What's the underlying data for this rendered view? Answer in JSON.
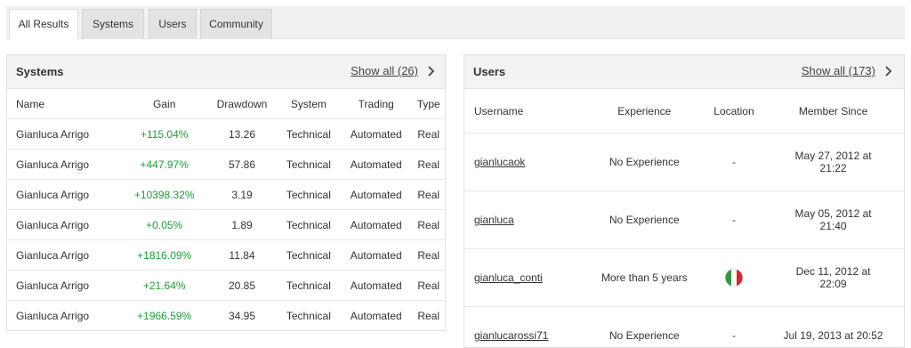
{
  "tabs": [
    "All Results",
    "Systems",
    "Users",
    "Community"
  ],
  "systems": {
    "title": "Systems",
    "show_all": "Show all (26)",
    "columns": [
      "Name",
      "Gain",
      "Drawdown",
      "System",
      "Trading",
      "Type"
    ],
    "rows": [
      {
        "name": "Gianluca Arrigo",
        "gain": "+115.04%",
        "drawdown": "13.26",
        "system": "Technical",
        "trading": "Automated",
        "type": "Real"
      },
      {
        "name": "Gianluca Arrigo",
        "gain": "+447.97%",
        "drawdown": "57.86",
        "system": "Technical",
        "trading": "Automated",
        "type": "Real"
      },
      {
        "name": "Gianluca Arrigo",
        "gain": "+10398.32%",
        "drawdown": "3.19",
        "system": "Technical",
        "trading": "Automated",
        "type": "Real"
      },
      {
        "name": "Gianluca Arrigo",
        "gain": "+0.05%",
        "drawdown": "1.89",
        "system": "Technical",
        "trading": "Automated",
        "type": "Real"
      },
      {
        "name": "Gianluca Arrigo",
        "gain": "+1816.09%",
        "drawdown": "11.84",
        "system": "Technical",
        "trading": "Automated",
        "type": "Real"
      },
      {
        "name": "Gianluca Arrigo",
        "gain": "+21.64%",
        "drawdown": "20.85",
        "system": "Technical",
        "trading": "Automated",
        "type": "Real"
      },
      {
        "name": "Gianluca Arrigo",
        "gain": "+1966.59%",
        "drawdown": "34.95",
        "system": "Technical",
        "trading": "Automated",
        "type": "Real"
      }
    ]
  },
  "users": {
    "title": "Users",
    "show_all": "Show all (173)",
    "columns": [
      "Username",
      "Experience",
      "Location",
      "Member Since"
    ],
    "rows": [
      {
        "username": "gianlucaok",
        "experience": "No Experience",
        "location": "-",
        "member_since": [
          "May 27, 2012 at",
          "21:22"
        ]
      },
      {
        "username": "gianluca",
        "experience": "No Experience",
        "location": "-",
        "member_since": [
          "May 05, 2012 at",
          "21:40"
        ]
      },
      {
        "username": "gianluca_conti",
        "experience": "More than 5 years",
        "location": "italy-flag-icon",
        "member_since": [
          "Dec 11, 2012 at",
          "22:09"
        ]
      },
      {
        "username": "gianlucarossi71",
        "experience": "No Experience",
        "location": "-",
        "member_since": [
          "Jul 19, 2013 at 20:52"
        ]
      }
    ]
  },
  "colors": {
    "gain_positive": "#1e9e3a",
    "flag_green": "#2e9a45",
    "flag_red": "#d8232a"
  }
}
